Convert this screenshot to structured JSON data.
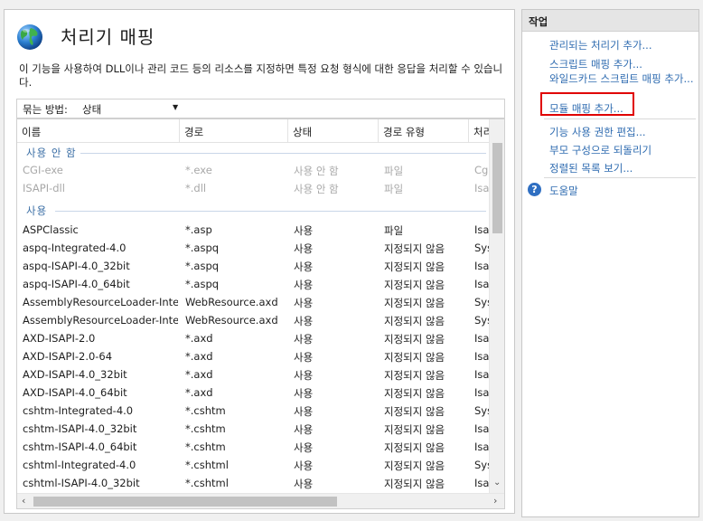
{
  "page": {
    "title": "처리기 매핑",
    "description": "이 기능을 사용하여 DLL이나 관리 코드 등의 리소스를 지정하면 특정 요청 형식에 대한 응답을 처리할 수 있습니다."
  },
  "group_by": {
    "label": "묶는 방법:",
    "value": "상태"
  },
  "columns": [
    "이름",
    "경로",
    "상태",
    "경로 유형",
    "처리"
  ],
  "groups": [
    {
      "label": "사용 안 함",
      "rows": [
        [
          "CGI-exe",
          "*.exe",
          "사용 안 함",
          "파일",
          "Cgi"
        ],
        [
          "ISAPI-dll",
          "*.dll",
          "사용 안 함",
          "파일",
          "Isap"
        ]
      ]
    },
    {
      "label": "사용",
      "rows": [
        [
          "ASPClassic",
          "*.asp",
          "사용",
          "파일",
          "Isap"
        ],
        [
          "aspq-Integrated-4.0",
          "*.aspq",
          "사용",
          "지정되지 않음",
          "Sys"
        ],
        [
          "aspq-ISAPI-4.0_32bit",
          "*.aspq",
          "사용",
          "지정되지 않음",
          "Isap"
        ],
        [
          "aspq-ISAPI-4.0_64bit",
          "*.aspq",
          "사용",
          "지정되지 않음",
          "Isap"
        ],
        [
          "AssemblyResourceLoader-Inte...",
          "WebResource.axd",
          "사용",
          "지정되지 않음",
          "Sys"
        ],
        [
          "AssemblyResourceLoader-Inte...",
          "WebResource.axd",
          "사용",
          "지정되지 않음",
          "Sys"
        ],
        [
          "AXD-ISAPI-2.0",
          "*.axd",
          "사용",
          "지정되지 않음",
          "Isap"
        ],
        [
          "AXD-ISAPI-2.0-64",
          "*.axd",
          "사용",
          "지정되지 않음",
          "Isap"
        ],
        [
          "AXD-ISAPI-4.0_32bit",
          "*.axd",
          "사용",
          "지정되지 않음",
          "Isap"
        ],
        [
          "AXD-ISAPI-4.0_64bit",
          "*.axd",
          "사용",
          "지정되지 않음",
          "Isap"
        ],
        [
          "cshtm-Integrated-4.0",
          "*.cshtm",
          "사용",
          "지정되지 않음",
          "Sys"
        ],
        [
          "cshtm-ISAPI-4.0_32bit",
          "*.cshtm",
          "사용",
          "지정되지 않음",
          "Isap"
        ],
        [
          "cshtm-ISAPI-4.0_64bit",
          "*.cshtm",
          "사용",
          "지정되지 않음",
          "Isap"
        ],
        [
          "cshtml-Integrated-4.0",
          "*.cshtml",
          "사용",
          "지정되지 않음",
          "Sys"
        ],
        [
          "cshtml-ISAPI-4.0_32bit",
          "*.cshtml",
          "사용",
          "지정되지 않음",
          "Isap"
        ]
      ]
    }
  ],
  "actions": {
    "header": "작업",
    "items": [
      "관리되는 처리기 추가...",
      "스크립트 매핑 추가...",
      "와일드카드 스크립트 매핑 추가...",
      "모듈 매핑 추가...",
      "기능 사용 권한 편집...",
      "부모 구성으로 되돌리기",
      "정렬된 목록 보기..."
    ],
    "help": "도움말",
    "help_icon": "question-icon"
  },
  "colors": {
    "link": "#2e6bb0",
    "highlight": "#e00000",
    "group": "#3a6ea5"
  }
}
